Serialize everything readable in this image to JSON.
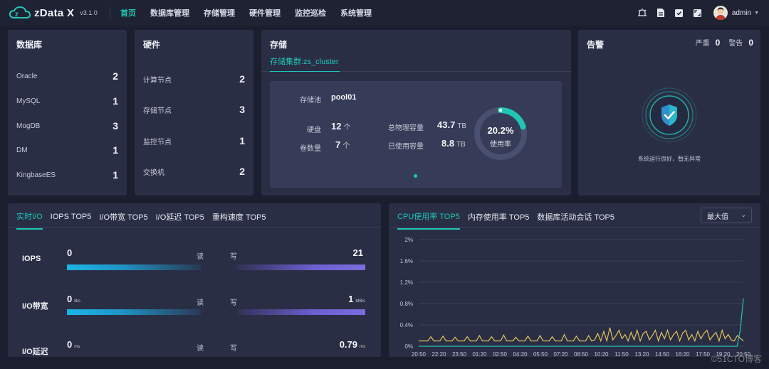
{
  "app": {
    "name": "zData X",
    "version": "v3.1.0"
  },
  "nav": [
    {
      "label": "首页",
      "active": true
    },
    {
      "label": "数据库管理",
      "active": false
    },
    {
      "label": "存储管理",
      "active": false
    },
    {
      "label": "硬件管理",
      "active": false
    },
    {
      "label": "监控巡检",
      "active": false
    },
    {
      "label": "系统管理",
      "active": false
    }
  ],
  "user": {
    "name": "admin"
  },
  "database": {
    "title": "数据库",
    "items": [
      {
        "label": "Oracle",
        "value": "2"
      },
      {
        "label": "MySQL",
        "value": "1"
      },
      {
        "label": "MogDB",
        "value": "3"
      },
      {
        "label": "DM",
        "value": "1"
      },
      {
        "label": "KingbaseES",
        "value": "1"
      }
    ]
  },
  "hardware": {
    "title": "硬件",
    "items": [
      {
        "label": "计算节点",
        "value": "2"
      },
      {
        "label": "存储节点",
        "value": "3"
      },
      {
        "label": "监控节点",
        "value": "1"
      },
      {
        "label": "交换机",
        "value": "2"
      }
    ]
  },
  "storage": {
    "title": "存储",
    "cluster": "存储集群:zs_cluster",
    "pool_label": "存储池",
    "pool_value": "pool01",
    "disk_label": "硬盘",
    "disk_value": "12",
    "disk_unit": "个",
    "volume_label": "卷数量",
    "volume_value": "7",
    "volume_unit": "个",
    "total_label": "总物理容量",
    "total_value": "43.7",
    "total_unit": "TB",
    "used_label": "已使用容量",
    "used_value": "8.8",
    "used_unit": "TB",
    "usage_percent": "20.2%",
    "usage_label": "使用率",
    "usage_fraction": 0.202
  },
  "alarm": {
    "title": "告警",
    "severe_label": "严重",
    "severe_value": "0",
    "warning_label": "警告",
    "warning_value": "0",
    "message": "系统运行良好，暂无异常"
  },
  "io_panel": {
    "tabs": [
      "实时I/O",
      "IOPS TOP5",
      "I/O带宽 TOP5",
      "I/O延迟 TOP5",
      "重构速度 TOP5"
    ],
    "read_label": "读",
    "write_label": "写",
    "rows": [
      {
        "label": "IOPS",
        "read": "0",
        "read_unit": "",
        "write": "21",
        "write_unit": ""
      },
      {
        "label": "I/O带宽",
        "read": "0",
        "read_unit": "B/s",
        "write": "1",
        "write_unit": "MB/s"
      },
      {
        "label": "I/O延迟",
        "read": "0",
        "read_unit": "ms",
        "write": "0.79",
        "write_unit": "ms"
      }
    ]
  },
  "cpu_panel": {
    "tabs": [
      "CPU使用率 TOP5",
      "内存使用率 TOP5",
      "数据库活动会话 TOP5"
    ],
    "select_value": "最大值"
  },
  "chart_data": {
    "type": "line",
    "title": "",
    "xlabel": "",
    "ylabel": "",
    "ylim": [
      0,
      2
    ],
    "y_ticks": [
      "2%",
      "1.6%",
      "1.2%",
      "0.8%",
      "0.4%",
      "0%"
    ],
    "x": [
      "20:50",
      "22:20",
      "23:50",
      "01:20",
      "02:50",
      "04:20",
      "05:50",
      "07:20",
      "08:50",
      "10:20",
      "11:50",
      "13:20",
      "14:50",
      "16:20",
      "17:50",
      "19:20",
      "20:50"
    ],
    "grid": true,
    "series": [
      {
        "color": "#e3c25a",
        "values": [
          0.1,
          0.1,
          0.1,
          0.1,
          0.18,
          0.1,
          0.1,
          0.1,
          0.19,
          0.1,
          0.1,
          0.1,
          0.17,
          0.1,
          0.1,
          0.1,
          0.18,
          0.1,
          0.1,
          0.1,
          0.2,
          0.1,
          0.1,
          0.1,
          0.18,
          0.1,
          0.1,
          0.1,
          0.21,
          0.1,
          0.1,
          0.1,
          0.17,
          0.1,
          0.1,
          0.1,
          0.19,
          0.1,
          0.1,
          0.1,
          0.2,
          0.1,
          0.1,
          0.1,
          0.18,
          0.1,
          0.1,
          0.1,
          0.22,
          0.1,
          0.1,
          0.1,
          0.19,
          0.1,
          0.1,
          0.1,
          0.2,
          0.1,
          0.12,
          0.24,
          0.1,
          0.28,
          0.1,
          0.35,
          0.12,
          0.2,
          0.3,
          0.14,
          0.22,
          0.1,
          0.26,
          0.12,
          0.3,
          0.1,
          0.24,
          0.28,
          0.12,
          0.2,
          0.3,
          0.1,
          0.26,
          0.14,
          0.3,
          0.12,
          0.22,
          0.28,
          0.1,
          0.25,
          0.3,
          0.12,
          0.22,
          0.1,
          0.28,
          0.14,
          0.24,
          0.3,
          0.12,
          0.2,
          0.26,
          0.1,
          0.3,
          0.14,
          0.22,
          0.12,
          0.1,
          0.2,
          0.15,
          0.1
        ]
      },
      {
        "color": "#1fc6b3",
        "values": [
          0,
          0,
          0,
          0,
          0,
          0,
          0,
          0,
          0,
          0,
          0,
          0,
          0,
          0,
          0,
          0,
          0,
          0,
          0,
          0,
          0,
          0,
          0,
          0,
          0,
          0,
          0,
          0,
          0,
          0,
          0,
          0,
          0,
          0,
          0,
          0,
          0,
          0,
          0,
          0,
          0,
          0,
          0,
          0,
          0,
          0,
          0,
          0,
          0,
          0,
          0,
          0,
          0,
          0,
          0,
          0,
          0,
          0,
          0,
          0,
          0,
          0,
          0,
          0,
          0,
          0,
          0,
          0,
          0,
          0,
          0,
          0,
          0,
          0,
          0,
          0,
          0,
          0,
          0,
          0,
          0,
          0,
          0,
          0,
          0,
          0,
          0,
          0,
          0,
          0,
          0,
          0,
          0,
          0,
          0,
          0,
          0,
          0,
          0,
          0,
          0,
          0,
          0,
          0.3,
          0.9
        ]
      }
    ]
  }
}
